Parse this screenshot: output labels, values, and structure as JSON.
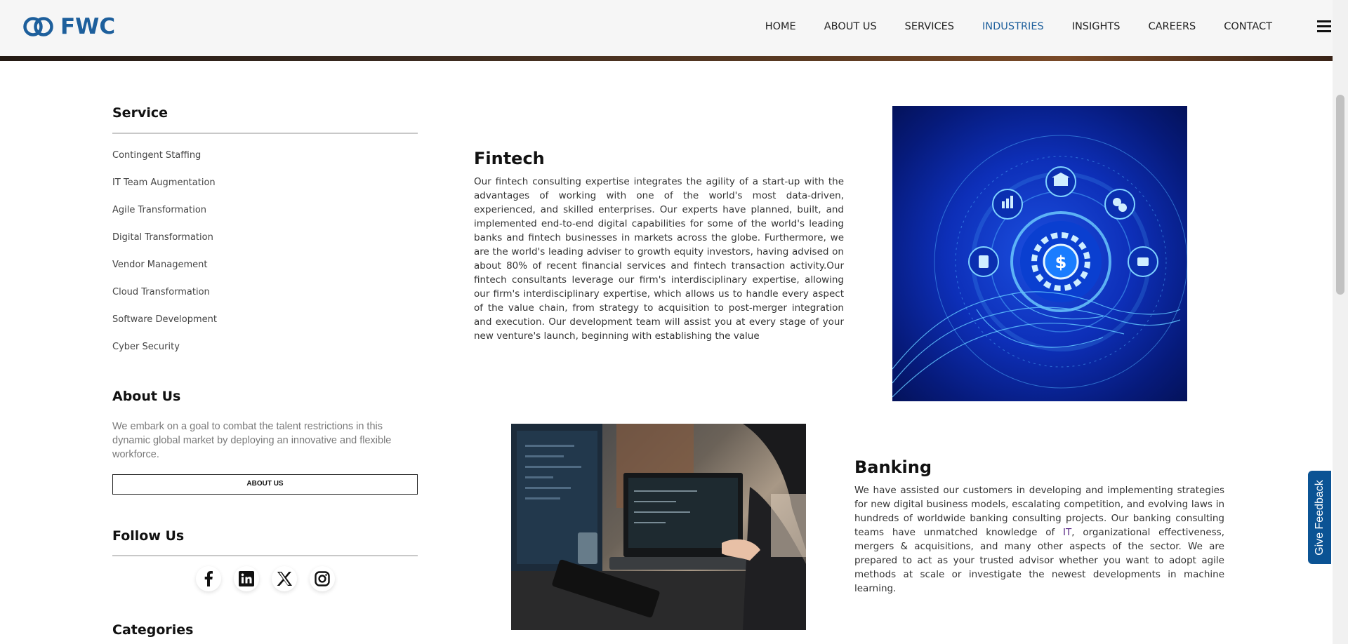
{
  "brand": {
    "logo_text": "FWC",
    "primary_color": "#1d5f9c"
  },
  "nav": {
    "items": [
      {
        "label": "HOME"
      },
      {
        "label": "ABOUT US"
      },
      {
        "label": "SERVICES"
      },
      {
        "label": "INDUSTRIES",
        "active": true
      },
      {
        "label": "INSIGHTS"
      },
      {
        "label": "CAREERS"
      },
      {
        "label": "CONTACT"
      }
    ],
    "menu_icon": "hamburger-icon"
  },
  "sidebar": {
    "service_heading": "Service",
    "services": [
      "Contingent Staffing",
      "IT Team Augmentation",
      "Agile Transformation",
      "Digital Transformation",
      "Vendor Management",
      "Cloud Transformation",
      "Software Development",
      "Cyber Security"
    ],
    "about_heading": "About Us",
    "about_text": "We embark on a goal to combat the talent restrictions in this dynamic global market by deploying an innovative and flexible workforce.",
    "about_button": "ABOUT US",
    "follow_heading": "Follow Us",
    "social_icons": [
      "facebook-icon",
      "linkedin-icon",
      "x-icon",
      "instagram-icon"
    ],
    "categories_heading": "Categories"
  },
  "fintech": {
    "title": "Fintech",
    "body": "Our fintech consulting expertise integrates the agility of a start-up with the advantages of working with one of the world's most data-driven, experienced, and skilled enterprises. Our experts have planned, built, and implemented end-to-end digital capabilities for some of the world's leading banks and fintech businesses in markets across the globe. Furthermore, we are the world's leading adviser to growth equity investors, having advised on about 80% of recent financial services and fintech transaction activity.Our fintech consultants leverage our firm's interdisciplinary expertise, allowing our firm's interdisciplinary expertise, which allows us to handle every aspect of the value chain, from strategy to acquisition to post-merger integration and execution. Our development team will assist you at every stage of your new venture's launch, beginning with establishing the value"
  },
  "banking": {
    "title": "Banking",
    "body_before": "We have assisted our customers in developing and implementing strategies for new digital business models, escalating competition, and evolving laws in hundreds of worldwide banking consulting projects. Our banking consulting teams have unmatched knowledge of ",
    "body_highlight": "IT",
    "body_after": ", organizational effectiveness, mergers & acquisitions, and many other aspects of the sector. We are prepared to act as your trusted advisor whether you want to adopt agile methods at scale or investigate the newest developments in machine learning."
  },
  "feedback": {
    "label": "Give Feedback",
    "color": "#0b5394"
  }
}
